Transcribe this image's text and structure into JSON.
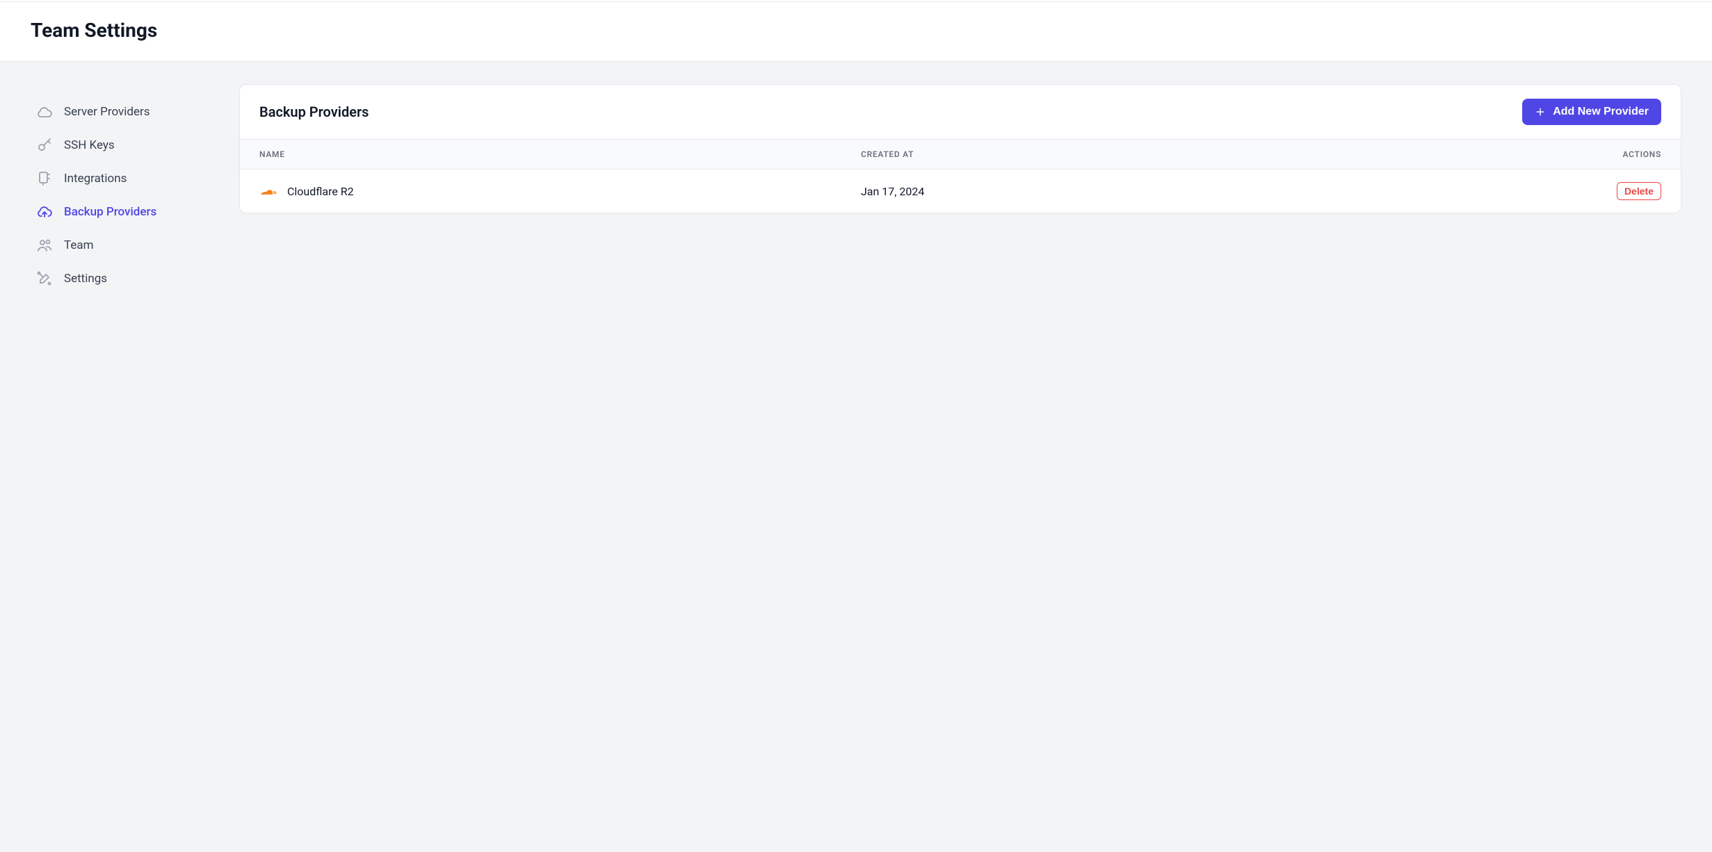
{
  "header": {
    "title": "Team Settings"
  },
  "sidebar": {
    "items": [
      {
        "label": "Server Providers",
        "icon": "cloud-icon",
        "active": false
      },
      {
        "label": "SSH Keys",
        "icon": "key-icon",
        "active": false
      },
      {
        "label": "Integrations",
        "icon": "plug-icon",
        "active": false
      },
      {
        "label": "Backup Providers",
        "icon": "cloud-upload-icon",
        "active": true
      },
      {
        "label": "Team",
        "icon": "users-icon",
        "active": false
      },
      {
        "label": "Settings",
        "icon": "tools-icon",
        "active": false
      }
    ]
  },
  "main": {
    "panel_title": "Backup Providers",
    "add_button_label": "Add New Provider",
    "columns": {
      "name": "Name",
      "created_at": "Created At",
      "actions": "Actions"
    },
    "rows": [
      {
        "icon": "cloudflare-icon",
        "name": "Cloudflare R2",
        "created_at": "Jan 17, 2024",
        "delete_label": "Delete"
      }
    ]
  }
}
